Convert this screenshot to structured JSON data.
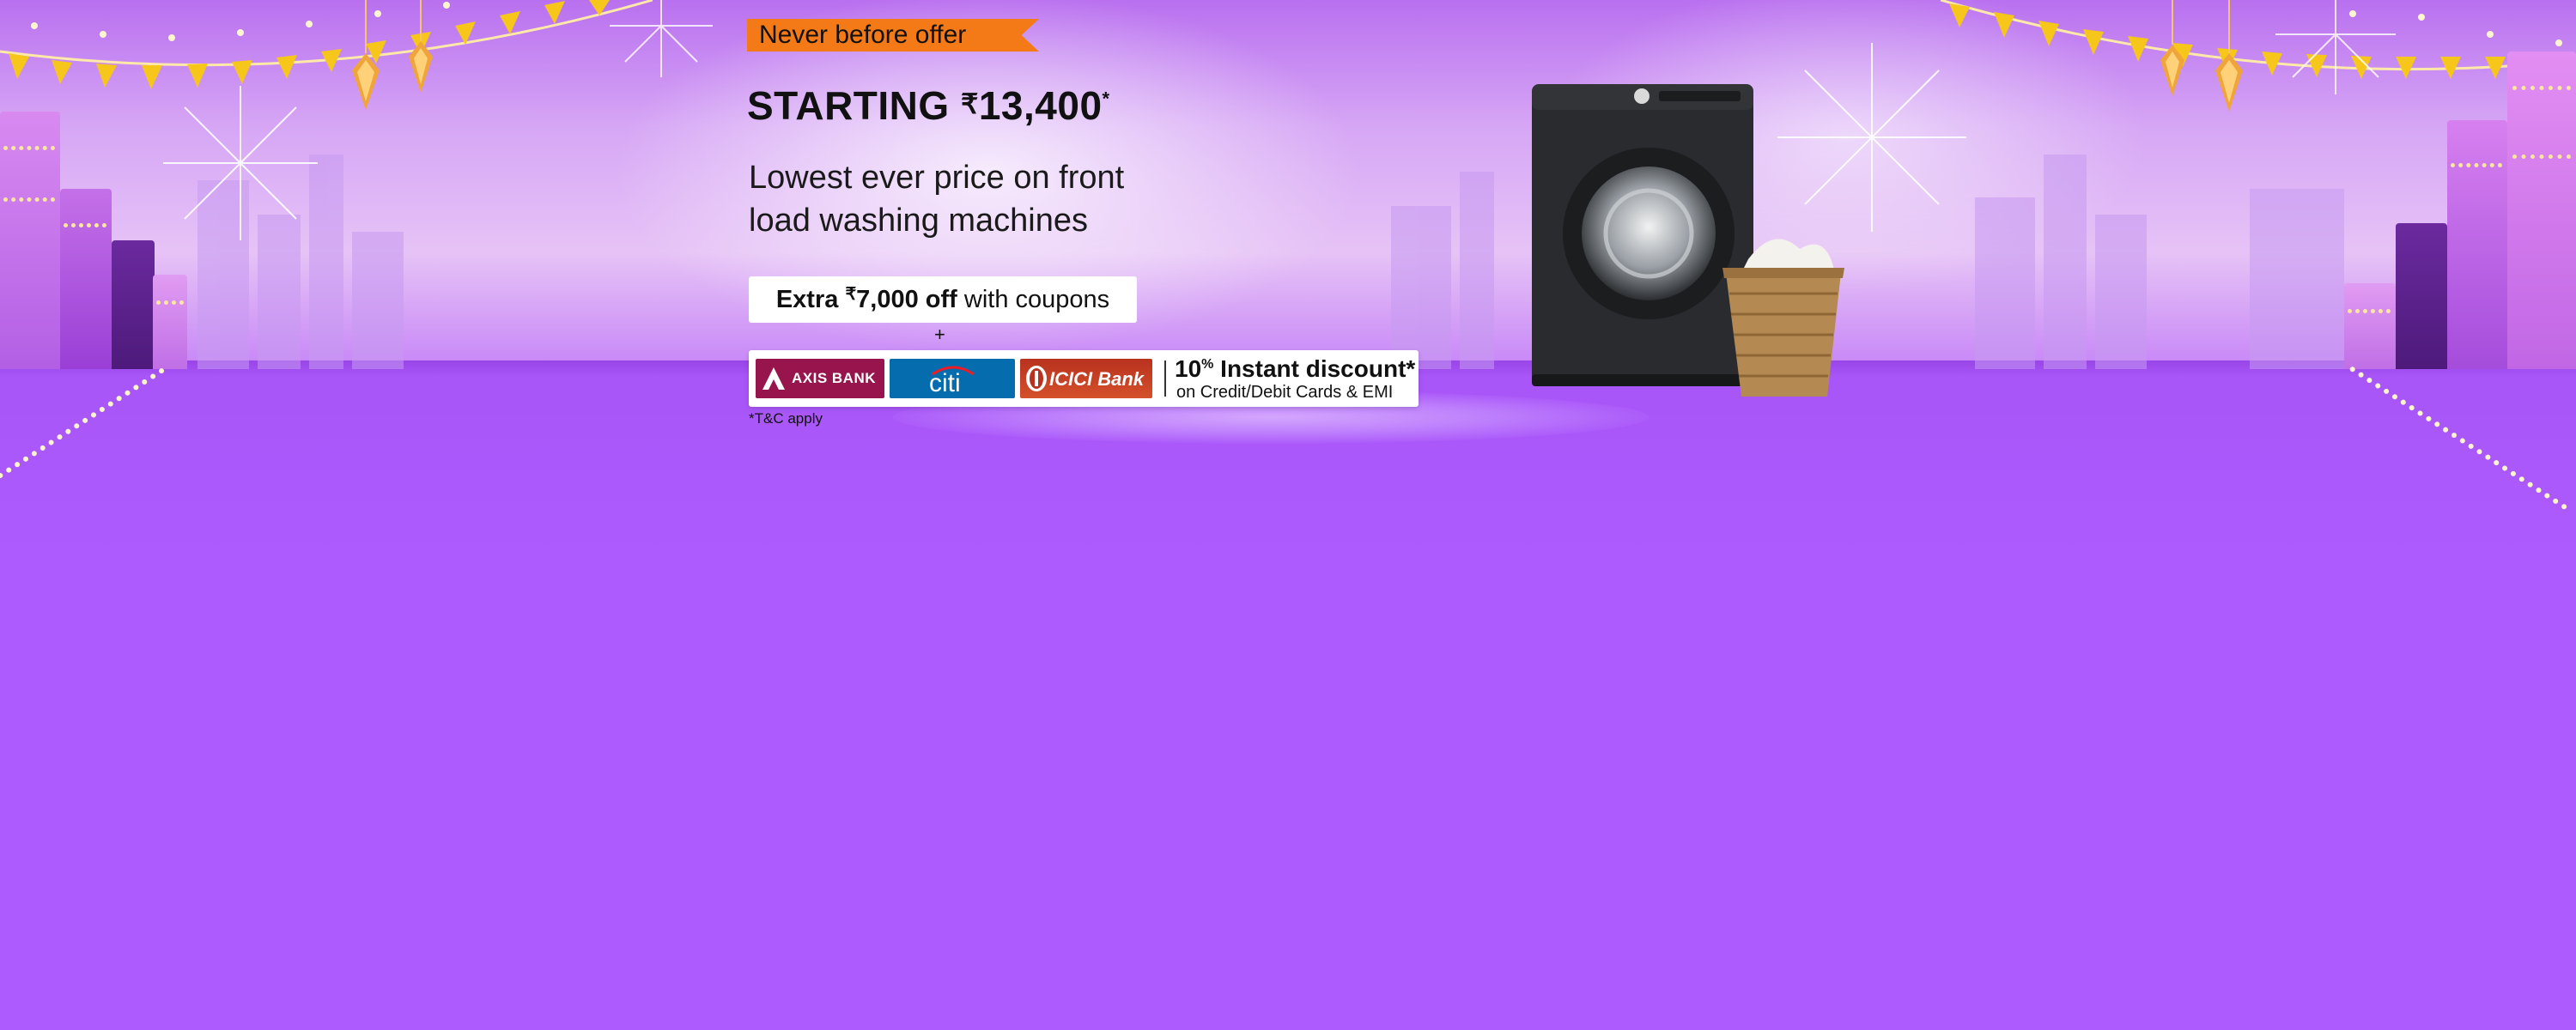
{
  "tag": "Never before offer",
  "headline": {
    "prefix": "STARTING ",
    "currency": "₹",
    "price": "13,400",
    "mark": "*"
  },
  "subline": {
    "line1": "Lowest ever price on front",
    "line2": "load washing machines"
  },
  "coupon": {
    "prefix": "Extra ",
    "currency": "₹",
    "amount": "7,000 off",
    "suffix": " with coupons"
  },
  "plus": "+",
  "banks": {
    "axis": "AXIS BANK",
    "citi": "citi",
    "icici": "ICICI Bank"
  },
  "discount": {
    "pct": "10",
    "pct_sign": "%",
    "title": " Instant discount*",
    "subtitle": "on Credit/Debit Cards & EMI"
  },
  "tnc": "*T&C apply",
  "colors": {
    "background": "#ad5bff",
    "tag": "#f37a16",
    "axis": "#97144d",
    "citi": "#056dae",
    "icici": "#c8442a"
  }
}
